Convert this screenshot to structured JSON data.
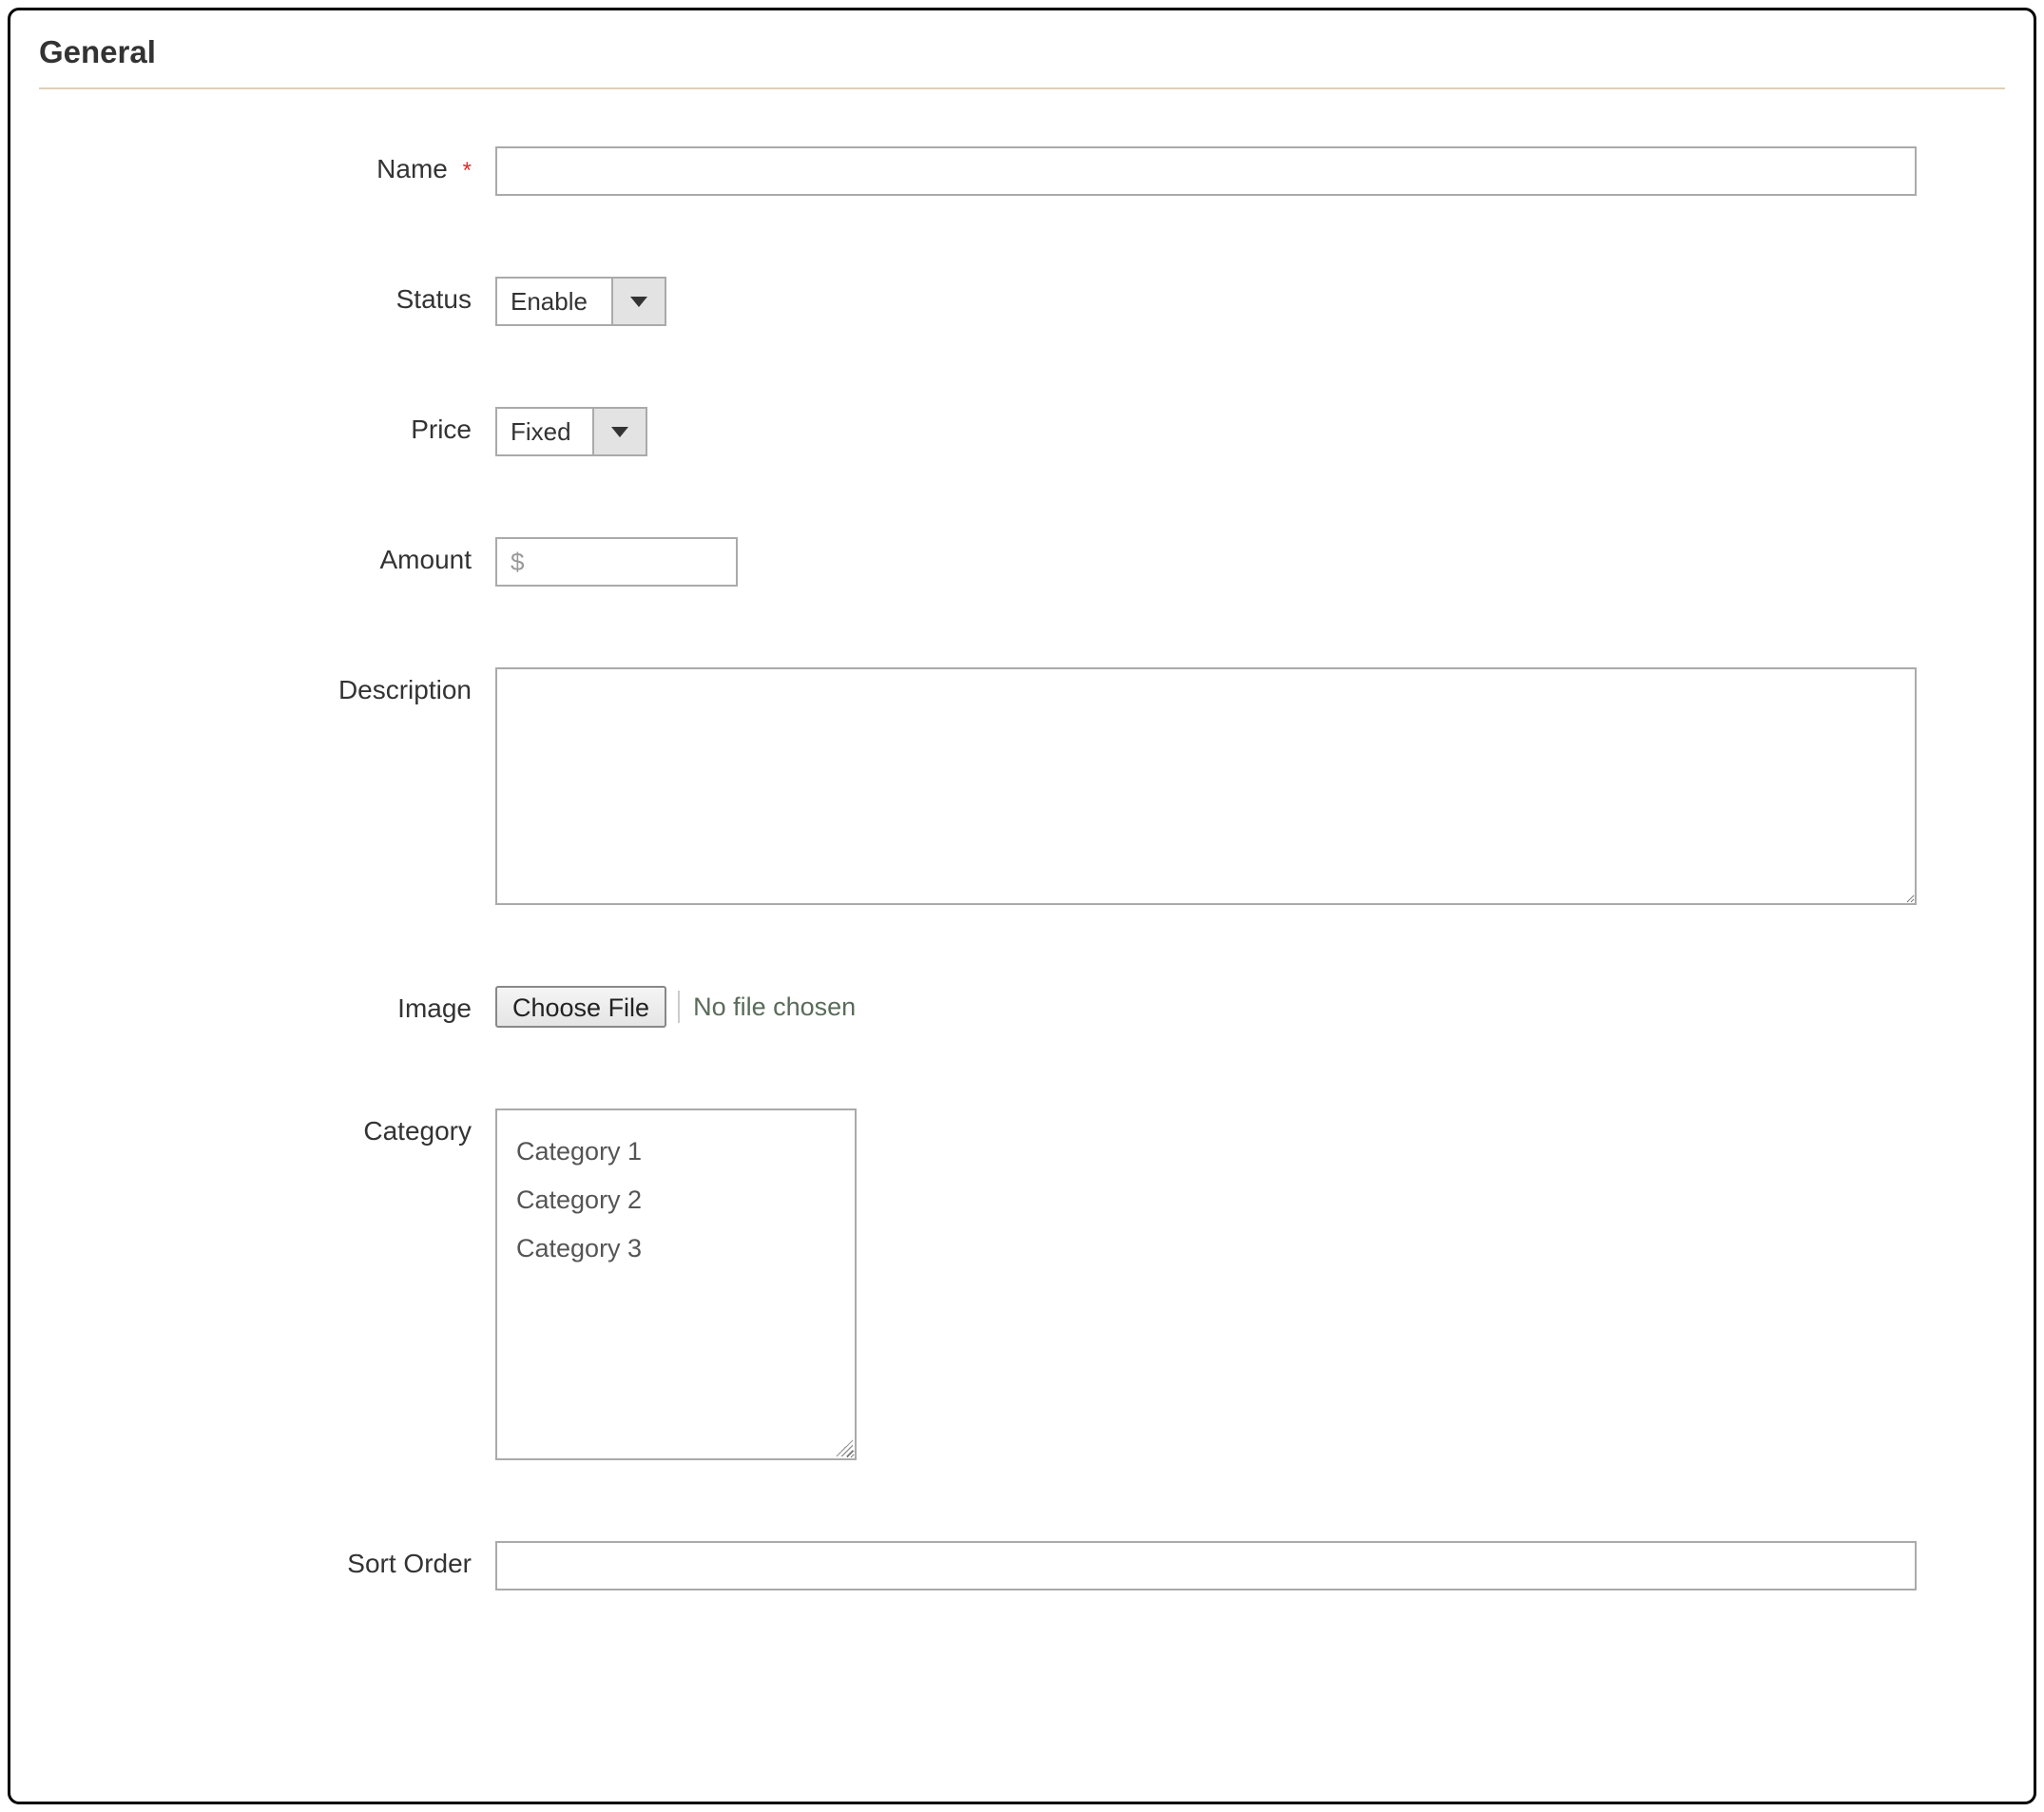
{
  "section": {
    "title": "General"
  },
  "fields": {
    "name": {
      "label": "Name",
      "value": "",
      "required": true
    },
    "status": {
      "label": "Status",
      "selected": "Enable"
    },
    "price": {
      "label": "Price",
      "selected": "Fixed"
    },
    "amount": {
      "label": "Amount",
      "currency_symbol": "$",
      "value": ""
    },
    "description": {
      "label": "Description",
      "value": ""
    },
    "image": {
      "label": "Image",
      "button_label": "Choose File",
      "status_text": "No file chosen"
    },
    "category": {
      "label": "Category",
      "options": [
        "Category 1",
        "Category 2",
        "Category 3"
      ]
    },
    "sort_order": {
      "label": "Sort Order",
      "value": ""
    }
  }
}
